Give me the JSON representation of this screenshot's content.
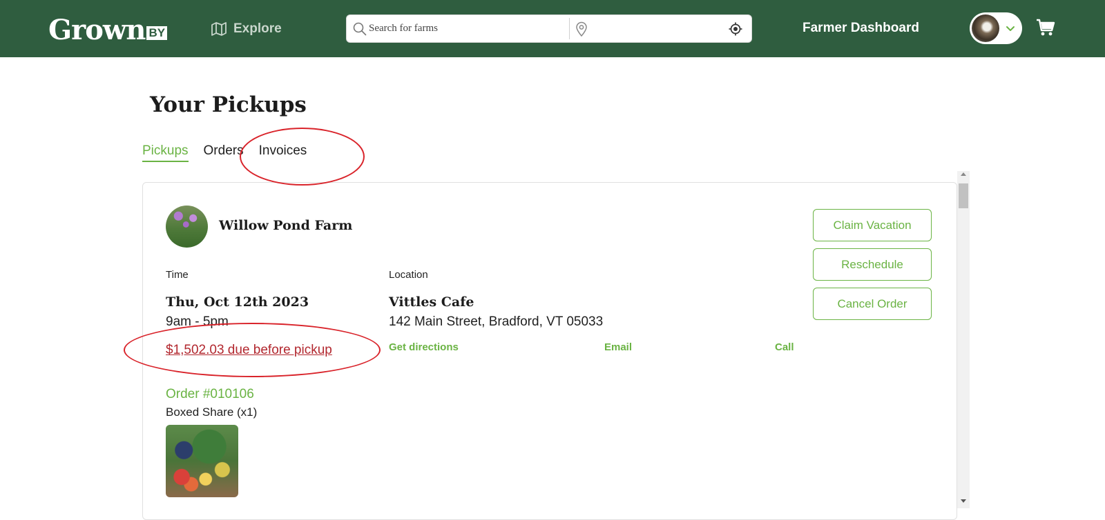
{
  "header": {
    "logo_main": "Grown",
    "logo_by": "BY",
    "explore_label": "Explore",
    "search_placeholder": "Search for farms",
    "location_placeholder": "",
    "farmer_dashboard_label": "Farmer Dashboard",
    "colors": {
      "bar": "#2f5d3f",
      "text": "#ffffff"
    }
  },
  "page": {
    "title": "Your Pickups",
    "tabs": [
      {
        "label": "Pickups",
        "active": true
      },
      {
        "label": "Orders",
        "active": false
      },
      {
        "label": "Invoices",
        "active": false
      }
    ]
  },
  "pickup": {
    "farm_name": "Willow Pond Farm",
    "time_label": "Time",
    "date": "Thu, Oct 12th 2023",
    "hours": "9am - 5pm",
    "due_text": "$1,502.03 due before pickup",
    "location_label": "Location",
    "location_name": "Vittles Cafe",
    "location_address": "142 Main Street, Bradford, VT 05033",
    "links": {
      "directions": "Get directions",
      "email": "Email",
      "call": "Call"
    },
    "buttons": {
      "claim_vacation": "Claim Vacation",
      "reschedule": "Reschedule",
      "cancel_order": "Cancel Order"
    },
    "order": {
      "number": "Order #010106",
      "item": "Boxed Share (x1)"
    }
  },
  "icons": [
    "map-icon",
    "search-icon",
    "location-pin-icon",
    "locate-target-icon",
    "chevron-down-icon",
    "cart-icon"
  ],
  "colors": {
    "accent": "#6ab343",
    "due": "#b2272e",
    "annotation": "#d9232a"
  }
}
